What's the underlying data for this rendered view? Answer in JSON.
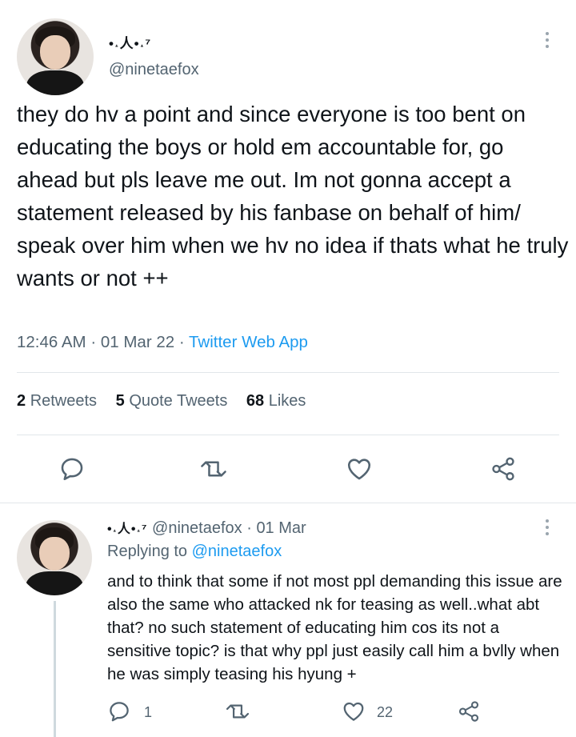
{
  "main_tweet": {
    "display_name": "•˔人•˔⁷",
    "handle": "@ninetaefox",
    "text": "they do hv a point and since everyone is too bent on educating the boys or hold em accountable for, go ahead but pls leave me out. Im not gonna accept a statement released by his fanbase on behalf of him/ speak over him when we hv no idea if thats what he truly wants or not ++",
    "time": "12:46 AM",
    "date": "01 Mar 22",
    "separator": "·",
    "source": "Twitter Web App",
    "stats": {
      "retweets_count": "2",
      "retweets_label": "Retweets",
      "quotes_count": "5",
      "quotes_label": "Quote Tweets",
      "likes_count": "68",
      "likes_label": "Likes"
    }
  },
  "reply_tweet": {
    "display_name": "•˔人•˔⁷",
    "handle": "@ninetaefox",
    "date": "01 Mar",
    "separator": "·",
    "replying_label": "Replying to",
    "replying_to": "@ninetaefox",
    "text": "and to think that some if not most ppl demanding this issue are also the same who attacked nk for teasing as well..what abt that? no such statement of educating him cos its not a sensitive topic? is that why ppl just easily call him a bvlly when he was simply teasing his hyung +",
    "reply_count": "1",
    "like_count": "22"
  },
  "colors": {
    "accent": "#1d9bf0",
    "secondary_text": "#536471",
    "divider": "#e1e6ea"
  }
}
